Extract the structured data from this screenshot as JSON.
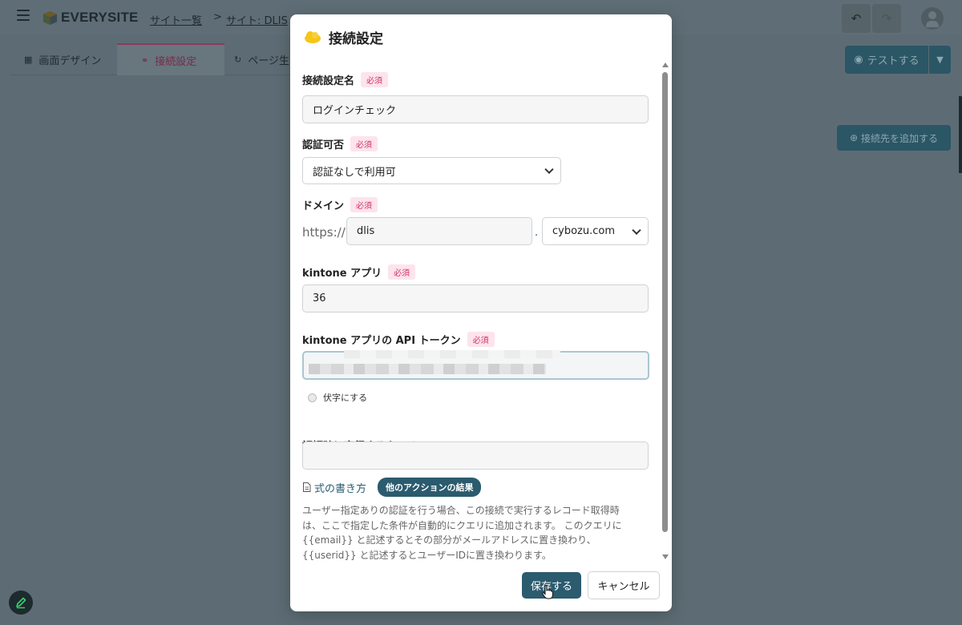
{
  "app": {
    "logo_text": "EVERYSITE",
    "breadcrumbs": [
      "サイト一覧",
      "サイト: DLIS"
    ],
    "breadcrumb_sep": ">",
    "tabs": [
      {
        "label": "画面デザイン",
        "icon": "layout-icon"
      },
      {
        "label": "接続設定",
        "icon": "connection-icon"
      },
      {
        "label": "ページ生",
        "icon": "refresh-icon"
      }
    ],
    "test_button": "テストする",
    "add_connection_button": "接続先を追加する"
  },
  "modal": {
    "title": "接続設定",
    "title_icon": "cloud-icon",
    "required_badge": "必須",
    "connection_name": {
      "label": "接続設定名",
      "value": "ログインチェック"
    },
    "auth": {
      "label": "認証可否",
      "value": "認証なしで利用可"
    },
    "domain": {
      "label": "ドメイン",
      "prefix": "https://",
      "subdomain": "dlis",
      "separator": ".",
      "suffix": "cybozu.com"
    },
    "kintone_app": {
      "label": "kintone アプリ",
      "value": "36"
    },
    "api_token": {
      "label": "kintone アプリの API トークン",
      "mask_label": "伏字にする"
    },
    "query": {
      "label": "認証時に実行するクエリ",
      "value": ""
    },
    "formula_link": "式の書き方",
    "other_actions_pill": "他のアクションの結果",
    "help_text": [
      "ユーザー指定ありの認証を行う場合、この接続で実行するレコード取得時",
      "は、ここで指定した条件が自動的にクエリに追加されます。 このクエリに",
      "{{email}} と記述するとその部分がメールアドレスに置き換わり、",
      "{{userid}} と記述するとユーザーIDに置き換わります。"
    ],
    "save_button": "保存する",
    "cancel_button": "キャンセル"
  },
  "colors": {
    "accent": "#2b5b6e",
    "required_bg": "#fde4ec",
    "required_text": "#d0326a",
    "overlay": "#5d6c74"
  }
}
